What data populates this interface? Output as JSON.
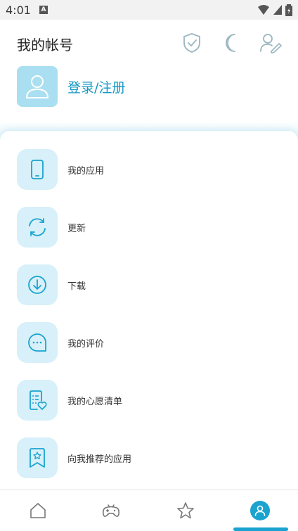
{
  "status": {
    "time": "4:01",
    "notif_icon": "A"
  },
  "header": {
    "title": "我的帐号",
    "icons": [
      "shield-check-icon",
      "moon-icon",
      "user-edit-icon"
    ]
  },
  "login": {
    "label": "登录/注册"
  },
  "menu": {
    "items": [
      {
        "label": "我的应用",
        "icon": "phone-icon"
      },
      {
        "label": "更新",
        "icon": "refresh-icon"
      },
      {
        "label": "下载",
        "icon": "download-icon"
      },
      {
        "label": "我的评价",
        "icon": "comment-icon"
      },
      {
        "label": "我的心愿清单",
        "icon": "wishlist-icon"
      },
      {
        "label": "向我推荐的应用",
        "icon": "recommend-icon"
      }
    ]
  },
  "nav": {
    "items": [
      "home-icon",
      "game-icon",
      "star-icon",
      "account-icon"
    ],
    "active": "account-icon"
  },
  "colors": {
    "accent": "#1aa3cf",
    "icon_bg": "#d7f0f9",
    "avatar_bg": "#a9dff0"
  }
}
